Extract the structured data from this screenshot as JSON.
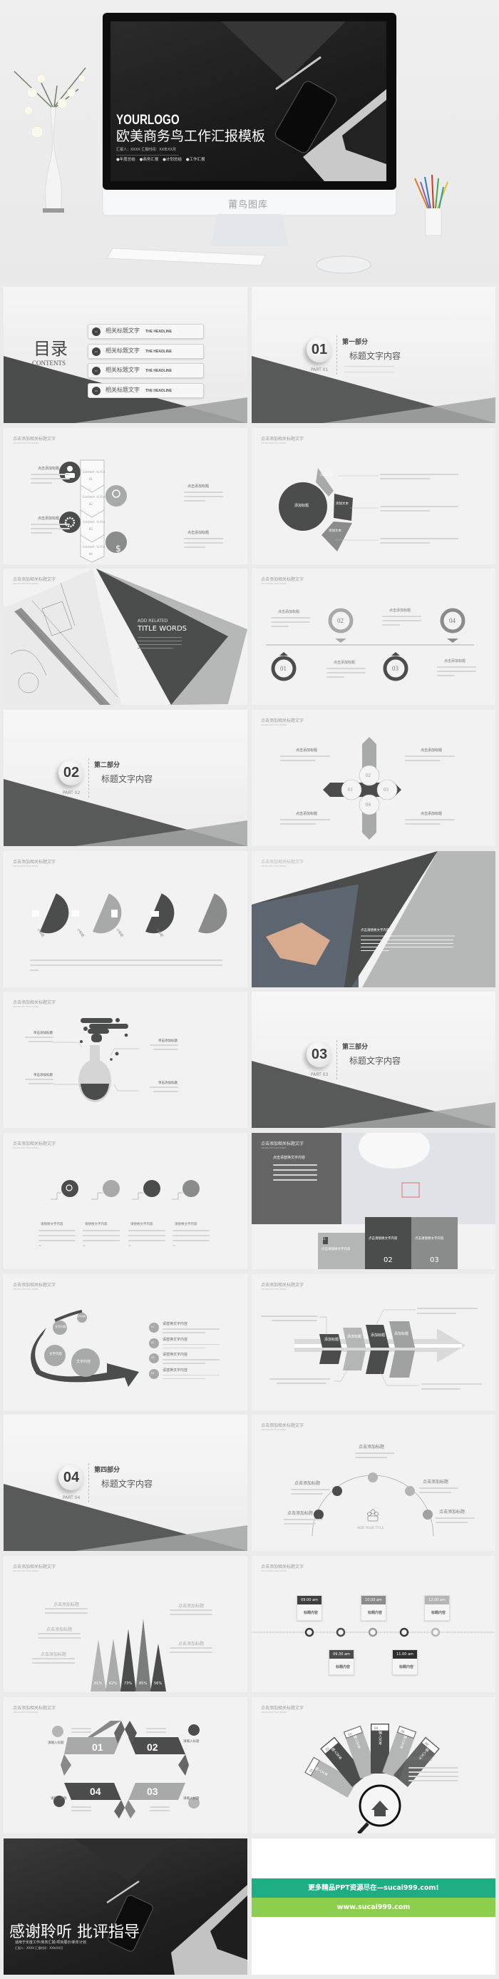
{
  "hero": {
    "logo": "YOURLOGO",
    "title": "欧美商务鸟工作汇报模板",
    "meta": "汇报人：XXXX 汇报时间：XX年XX月",
    "tags": [
      "●年度总结",
      "●商务汇报",
      "●计划总结",
      "●工作汇报"
    ],
    "brand": "莆鸟图库"
  },
  "common": {
    "header": "点击添加相关标题文字",
    "header_en": "ADD RELATED TITLE WORDS",
    "add_title": "点击添加标题"
  },
  "contents": {
    "title": "目录",
    "subtitle": "CONTENTS",
    "items": [
      {
        "n": "01",
        "cn": "相关标题文字",
        "en": "THE HEADLINE"
      },
      {
        "n": "02",
        "cn": "相关标题文字",
        "en": "THE HEADLINE"
      },
      {
        "n": "03",
        "cn": "相关标题文字",
        "en": "THE HEADLINE"
      },
      {
        "n": "04",
        "cn": "相关标题文字",
        "en": "THE HEADLINE"
      }
    ]
  },
  "sections": [
    {
      "num": "01",
      "part": "PART 01",
      "name": "第一部分",
      "title": "标题文字内容"
    },
    {
      "num": "02",
      "part": "PART 02",
      "name": "第二部分",
      "title": "标题文字内容"
    },
    {
      "num": "03",
      "part": "PART 03",
      "name": "第三部分",
      "title": "标题文字内容"
    },
    {
      "num": "04",
      "part": "PART 04",
      "name": "第四部分",
      "title": "标题文字内容"
    }
  ],
  "process": {
    "steps": [
      "Content title",
      "Content title",
      "Content title",
      "Content title"
    ],
    "nums": [
      "01",
      "02",
      "03",
      "04"
    ]
  },
  "arc": {
    "center": "添加标题",
    "segments": [
      "添加文本",
      "添加文本",
      "添加文本"
    ]
  },
  "blueprint": {
    "line1": "ADD RELATED",
    "line2": "TITLE WORDS"
  },
  "rings": {
    "nums": [
      "01",
      "02",
      "03",
      "04"
    ]
  },
  "cross": {
    "nums": [
      "01",
      "02",
      "03",
      "04"
    ]
  },
  "pins": {
    "label": "小标题"
  },
  "handshake": {
    "caption": "点击请替换文字内容"
  },
  "flask": {
    "label": "单击添加标题"
  },
  "icons4": {
    "label": "请替换文字内容"
  },
  "cards": {
    "photo_title": "点击请替换文字内容",
    "card_title": "点击请替换文字内容",
    "nums": [
      "01",
      "02",
      "03"
    ]
  },
  "curve": {
    "bubble": "文字内容",
    "list_title": "请替换文字内容",
    "nums": [
      "01",
      "02",
      "03",
      "04"
    ]
  },
  "fishbone": {
    "label": "添加标题"
  },
  "semicircle": {
    "center": "ADD YOUR TITLE"
  },
  "chart_data": {
    "type": "bar",
    "categories": [
      "1",
      "2",
      "3",
      "4",
      "5"
    ],
    "values": [
      61,
      62,
      73,
      85,
      56
    ],
    "value_labels": [
      "61%",
      "62%",
      "73%",
      "85%",
      "56%"
    ],
    "ylim": [
      0,
      100
    ],
    "colors": [
      "#b4b4b4",
      "#a9aaaa",
      "#4b4c4c",
      "#7b7c7c",
      "#4b4c4c"
    ]
  },
  "timeline": {
    "times": [
      "09.00 am",
      "09.30 am",
      "10.00 am",
      "11.00 am",
      "12.00 am"
    ],
    "label": "标题内容"
  },
  "ribbon": {
    "nums": [
      "01",
      "02",
      "03",
      "04"
    ],
    "label": "请输入标题"
  },
  "fan": {
    "nums": [
      "01",
      "02",
      "03",
      "04",
      "05",
      "06"
    ],
    "text": "输入文本",
    "title": "点击添加标题"
  },
  "thanks": {
    "title": "感谢聆听 批评指导",
    "subtitle": "适用于年度工作/商务汇报/项目展示/新年计划",
    "meta": "汇报人：XXXX 汇报时间：XX年XX月"
  },
  "ad": {
    "line1": "更多精品PPT资源尽在—sucai999.com!",
    "line2": "www.sucai999.com",
    "color1": "#1fae84",
    "color2": "#8ccf4d"
  },
  "palette": {
    "dark": "#4b4c4c",
    "mid": "#8a8b8b",
    "light": "#b6b7b7",
    "bg": "#f2f2f2"
  }
}
